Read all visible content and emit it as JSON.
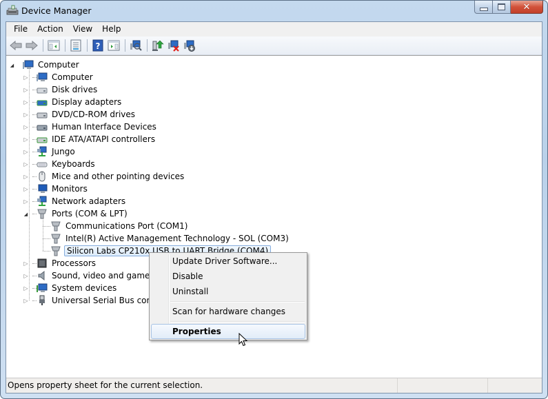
{
  "window": {
    "title": "Device Manager",
    "controls": {
      "minimize": "minimize",
      "maximize": "maximize",
      "close": "close"
    }
  },
  "menubar": [
    "File",
    "Action",
    "View",
    "Help"
  ],
  "toolbar": [
    {
      "name": "back",
      "icon": "back-arrow-icon"
    },
    {
      "name": "forward",
      "icon": "forward-arrow-icon"
    },
    {
      "name": "show-hide-console-tree",
      "icon": "console-tree-icon"
    },
    {
      "name": "properties",
      "icon": "properties-sheet-icon"
    },
    {
      "name": "help",
      "icon": "help-icon"
    },
    {
      "name": "show-hide-action-pane",
      "icon": "action-pane-icon"
    },
    {
      "name": "scan-hardware",
      "icon": "scan-hardware-icon"
    },
    {
      "name": "update-driver",
      "icon": "update-driver-icon"
    },
    {
      "name": "uninstall",
      "icon": "uninstall-icon"
    },
    {
      "name": "disable",
      "icon": "disable-icon"
    }
  ],
  "tree": {
    "root": "Computer",
    "categories": [
      {
        "label": "Computer",
        "icon": "computer-icon"
      },
      {
        "label": "Disk drives",
        "icon": "disk-drive-icon"
      },
      {
        "label": "Display adapters",
        "icon": "display-adapter-icon"
      },
      {
        "label": "DVD/CD-ROM drives",
        "icon": "dvd-drive-icon"
      },
      {
        "label": "Human Interface Devices",
        "icon": "hid-icon"
      },
      {
        "label": "IDE ATA/ATAPI controllers",
        "icon": "ide-controller-icon"
      },
      {
        "label": "Jungo",
        "icon": "network-icon"
      },
      {
        "label": "Keyboards",
        "icon": "keyboard-icon"
      },
      {
        "label": "Mice and other pointing devices",
        "icon": "mouse-icon"
      },
      {
        "label": "Monitors",
        "icon": "monitor-icon"
      },
      {
        "label": "Network adapters",
        "icon": "network-adapter-icon"
      },
      {
        "label": "Ports (COM & LPT)",
        "icon": "port-icon",
        "expanded": true,
        "children": [
          {
            "label": "Communications Port (COM1)",
            "icon": "port-icon"
          },
          {
            "label": "Intel(R) Active Management Technology - SOL (COM3)",
            "icon": "port-icon"
          },
          {
            "label": "Silicon Labs CP210x USB to UART Bridge (COM4)",
            "icon": "port-icon",
            "selected": true
          }
        ]
      },
      {
        "label": "Processors",
        "icon": "processor-icon"
      },
      {
        "label": "Sound, video and game controllers",
        "icon": "speaker-icon"
      },
      {
        "label": "System devices",
        "icon": "system-device-icon"
      },
      {
        "label": "Universal Serial Bus controllers",
        "icon": "usb-icon"
      }
    ]
  },
  "context_menu": {
    "items": [
      "Update Driver Software...",
      "Disable",
      "Uninstall",
      "Scan for hardware changes",
      "Properties"
    ],
    "highlighted": "Properties"
  },
  "statusbar": {
    "text": "Opens property sheet for the current selection."
  },
  "colors": {
    "selection_border": "#84acdd",
    "close_button": "#d2523a",
    "frame": "#b9d1ea"
  }
}
